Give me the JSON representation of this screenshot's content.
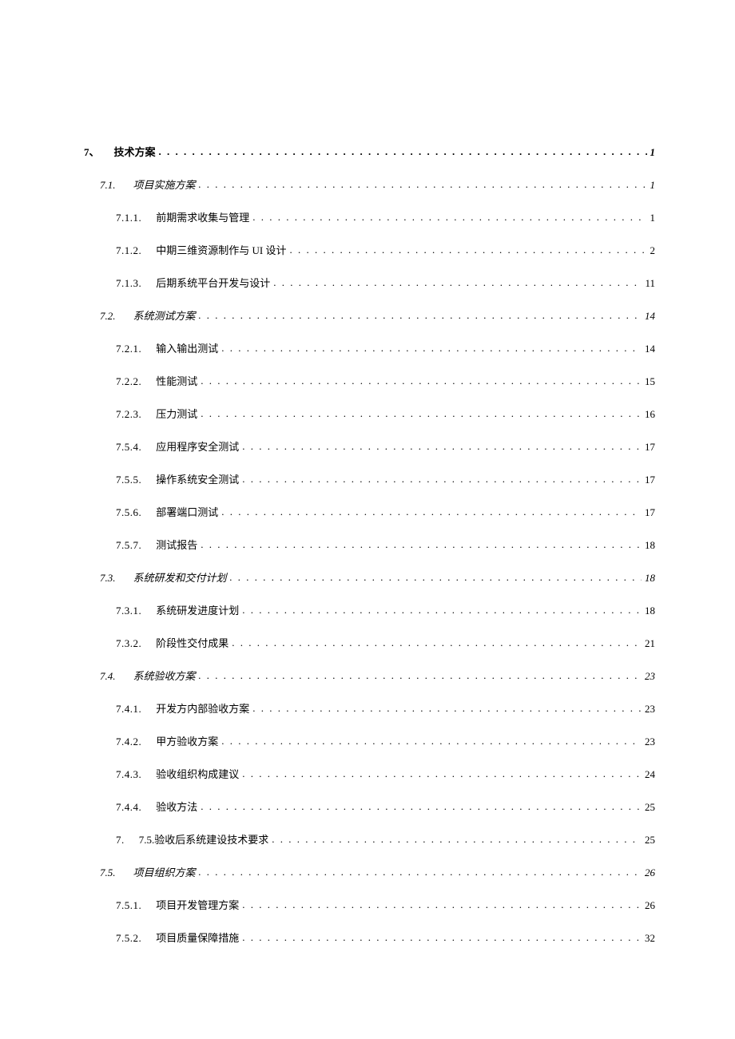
{
  "toc": [
    {
      "level": 1,
      "number": "7、",
      "title": "技术方案",
      "page": "1"
    },
    {
      "level": 2,
      "number": "7.1.",
      "title": "项目实施方案",
      "page": "1"
    },
    {
      "level": 3,
      "number": "7.1.1.",
      "title": "前期需求收集与管理",
      "page": "1"
    },
    {
      "level": 3,
      "number": "7.1.2.",
      "title": "中期三维资源制作与 UI 设计",
      "page": "2"
    },
    {
      "level": 3,
      "number": "7.1.3.",
      "title": "后期系统平台开发与设计",
      "page": "11"
    },
    {
      "level": 2,
      "number": "7.2.",
      "title": "系统测试方案",
      "page": "14"
    },
    {
      "level": 3,
      "number": "7.2.1.",
      "title": "输入输出测试",
      "page": "14"
    },
    {
      "level": 3,
      "number": "7.2.2.",
      "title": "性能测试",
      "page": "15"
    },
    {
      "level": 3,
      "number": "7.2.3.",
      "title": "压力测试",
      "page": "16"
    },
    {
      "level": 3,
      "number": "7.5.4.",
      "title": "应用程序安全测试",
      "page": "17"
    },
    {
      "level": 3,
      "number": "7.5.5.",
      "title": "操作系统安全测试",
      "page": "17"
    },
    {
      "level": 3,
      "number": "7.5.6.",
      "title": "部署端口测试",
      "page": "17"
    },
    {
      "level": 3,
      "number": "7.5.7.",
      "title": "测试报告",
      "page": "18"
    },
    {
      "level": 2,
      "number": "7.3.",
      "title": "系统研发和交付计划",
      "page": "18"
    },
    {
      "level": 3,
      "number": "7.3.1.",
      "title": "系统研发进度计划",
      "page": "18"
    },
    {
      "level": 3,
      "number": "7.3.2.",
      "title": "阶段性交付成果",
      "page": "21"
    },
    {
      "level": 2,
      "number": "7.4.",
      "title": "系统验收方案",
      "page": "23"
    },
    {
      "level": 3,
      "number": "7.4.1.",
      "title": "开发方内部验收方案",
      "page": "23"
    },
    {
      "level": 3,
      "number": "7.4.2.",
      "title": "甲方验收方案",
      "page": "23"
    },
    {
      "level": 3,
      "number": "7.4.3.",
      "title": "验收组织构成建议",
      "page": "24"
    },
    {
      "level": 3,
      "number": "7.4.4.",
      "title": "验收方法",
      "page": "25"
    },
    {
      "level": 3,
      "number": "7.",
      "title": "7.5.验收后系统建设技术要求",
      "page": "25"
    },
    {
      "level": 2,
      "number": "7.5.",
      "title": "项目组织方案",
      "page": "26"
    },
    {
      "level": 3,
      "number": "7.5.1.",
      "title": "项目开发管理方案",
      "page": "26"
    },
    {
      "level": 3,
      "number": "7.5.2.",
      "title": "项目质量保障措施",
      "page": "32"
    }
  ]
}
